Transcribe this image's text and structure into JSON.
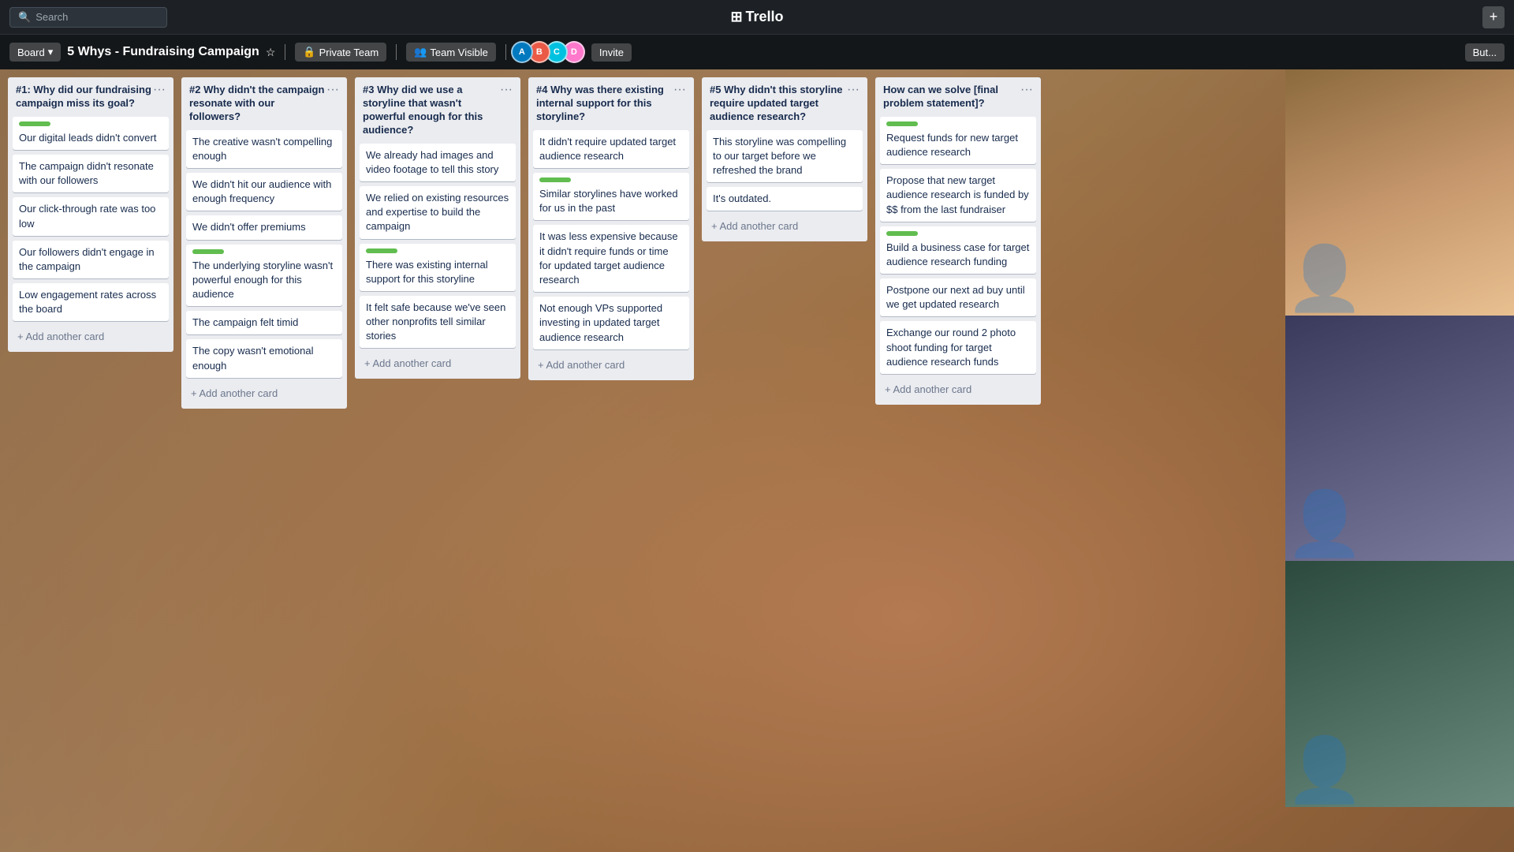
{
  "topbar": {
    "search_placeholder": "Search",
    "logo": "Trello",
    "add_label": "+",
    "board_label": "Board"
  },
  "board": {
    "title": "5 Whys - Fundraising Campaign",
    "visibility": "Private Team",
    "team_visible": "Team Visible",
    "invite_label": "Invite",
    "butler_label": "But...",
    "star_icon": "☆"
  },
  "lists": [
    {
      "id": "list1",
      "title": "#1: Why did our fundraising campaign miss its goal?",
      "cards": [
        {
          "text": "Our digital leads didn't convert",
          "has_label": true
        },
        {
          "text": "The campaign didn't resonate with our followers",
          "has_label": false
        },
        {
          "text": "Our click-through rate was too low",
          "has_label": false
        },
        {
          "text": "Our followers didn't engage in the campaign",
          "has_label": false
        },
        {
          "text": "Low engagement rates across the board",
          "has_label": false
        }
      ],
      "add_label": "+ Add another card"
    },
    {
      "id": "list2",
      "title": "#2 Why didn't the campaign resonate with our followers?",
      "cards": [
        {
          "text": "The creative wasn't compelling enough",
          "has_label": false
        },
        {
          "text": "We didn't hit our audience with enough frequency",
          "has_label": false
        },
        {
          "text": "We didn't offer premiums",
          "has_label": false
        },
        {
          "text": "The underlying storyline wasn't powerful enough for this audience",
          "has_label": true
        },
        {
          "text": "The campaign felt timid",
          "has_label": false
        },
        {
          "text": "The copy wasn't emotional enough",
          "has_label": false
        }
      ],
      "add_label": "+ Add another card"
    },
    {
      "id": "list3",
      "title": "#3 Why did we use a storyline that wasn't powerful enough for this audience?",
      "cards": [
        {
          "text": "We already had images and video footage to tell this story",
          "has_label": false
        },
        {
          "text": "We relied on existing resources and expertise to build the campaign",
          "has_label": false
        },
        {
          "text": "There was existing internal support for this storyline",
          "has_label": true
        },
        {
          "text": "It felt safe because we've seen other nonprofits tell similar stories",
          "has_label": false
        }
      ],
      "add_label": "+ Add another card"
    },
    {
      "id": "list4",
      "title": "#4 Why was there existing internal support for this storyline?",
      "cards": [
        {
          "text": "It didn't require updated target audience research",
          "has_label": false
        },
        {
          "text": "Similar storylines have worked for us in the past",
          "has_label": true
        },
        {
          "text": "It was less expensive because it didn't require funds or time for updated target audience research",
          "has_label": false
        },
        {
          "text": "Not enough VPs supported investing in updated target audience research",
          "has_label": false
        }
      ],
      "add_label": "+ Add another card"
    },
    {
      "id": "list5",
      "title": "#5 Why didn't this storyline require updated target audience research?",
      "cards": [
        {
          "text": "This storyline was compelling to our target before we refreshed the brand",
          "has_label": false
        },
        {
          "text": "It's outdated.",
          "has_label": false
        }
      ],
      "add_label": "+ Add another card"
    },
    {
      "id": "list6",
      "title": "How can we solve [final problem statement]?",
      "cards": [
        {
          "text": "Request funds for new target audience research",
          "has_label": true
        },
        {
          "text": "Propose that new target audience research is funded by $$ from the last fundraiser",
          "has_label": false
        },
        {
          "text": "Build a business case for target audience research funding",
          "has_label": true
        },
        {
          "text": "Postpone our next ad buy until we get updated research",
          "has_label": false
        },
        {
          "text": "Exchange our round 2 photo shoot funding for target audience research funds",
          "has_label": false
        }
      ],
      "add_label": "+ Add another card"
    }
  ],
  "avatars": [
    {
      "color": "#0079bf",
      "initial": "A"
    },
    {
      "color": "#eb5a46",
      "initial": "B"
    },
    {
      "color": "#00c2e0",
      "initial": "C"
    },
    {
      "color": "#ff78cb",
      "initial": "D"
    }
  ],
  "icons": {
    "search": "🔍",
    "menu_dots": "···",
    "star": "☆",
    "plus": "+",
    "trello_icon": "⊞"
  }
}
